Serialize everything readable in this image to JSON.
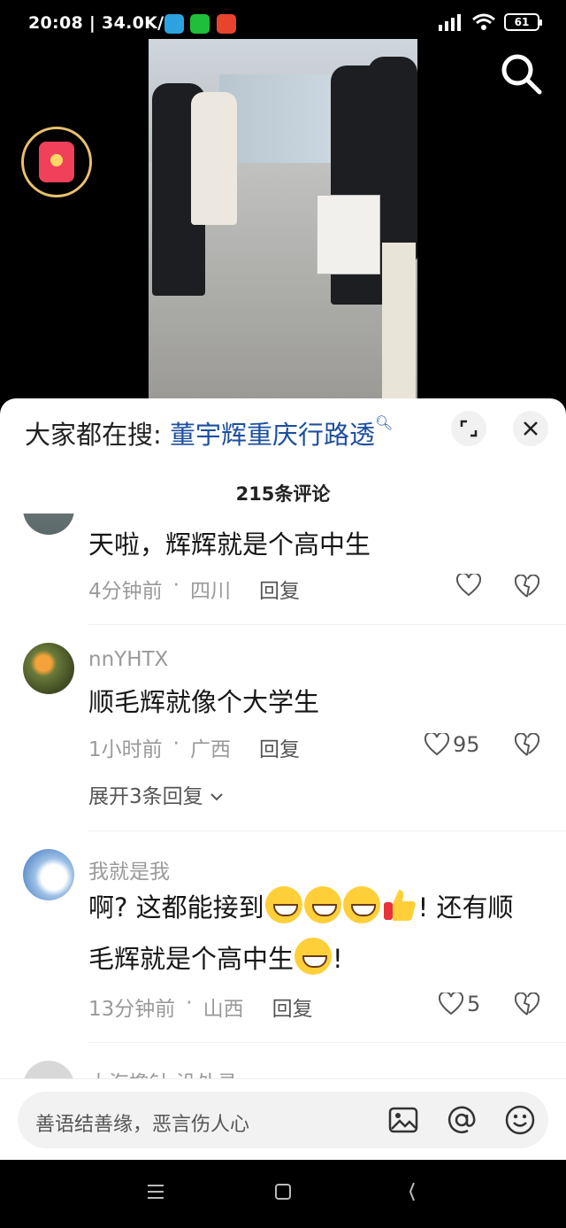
{
  "status_bar": {
    "time": "20:08 | 34.0K/s",
    "battery": "61"
  },
  "hot_search": {
    "prefix": "大家都在搜: ",
    "term": "董宇辉重庆行路透"
  },
  "comments_count": "215条评论",
  "comments": [
    {
      "text": "天啦，辉辉就是个高中生",
      "time": "4分钟前",
      "location": "四川",
      "reply": "回复",
      "likes": ""
    },
    {
      "user": "nnYHTX",
      "text": "顺毛辉就像个大学生",
      "time": "1小时前",
      "location": "广西",
      "reply": "回复",
      "likes": "95",
      "expand": "展开3条回复"
    },
    {
      "user": "我就是我",
      "text_a": "啊? 这都能接到",
      "text_b": "! 还有顺",
      "text_c": "毛辉就是个高中生",
      "text_d": "!",
      "time": "13分钟前",
      "location": "山西",
      "reply": "回复",
      "likes": "5"
    },
    {
      "user": "大海撸针 没处寻"
    }
  ],
  "input": {
    "placeholder": "善语结善缘，恶言伤人心"
  },
  "colors": {
    "accent_link": "#1d4f9e",
    "sheet_bg": "#ffffff",
    "red_packet": "#f0405a"
  }
}
